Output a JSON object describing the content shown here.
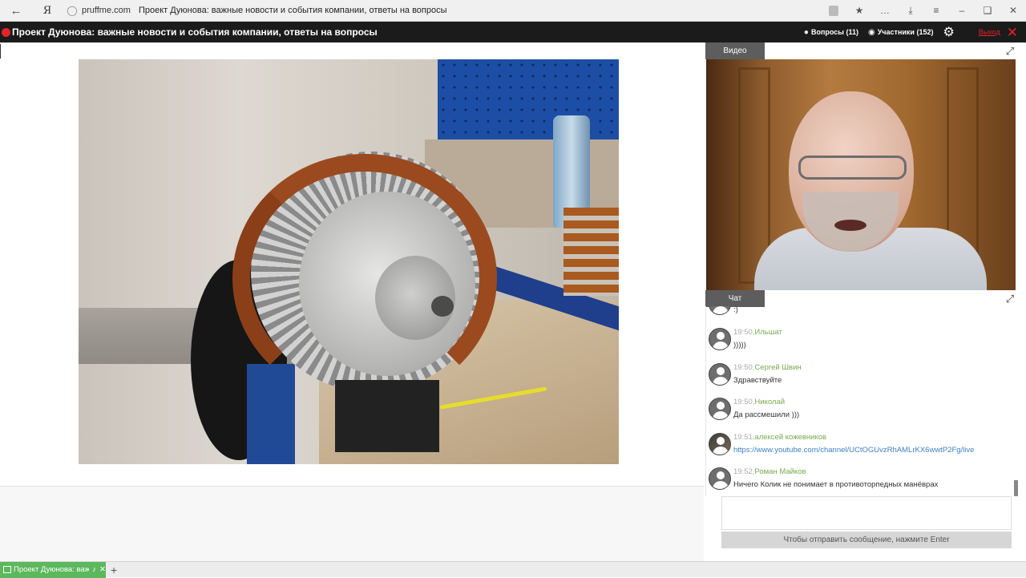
{
  "browser": {
    "back_icon": "arrow-left-icon",
    "logo": "Я",
    "domain": "pruffme.com",
    "page_title": "Проект Дуюнова: важные новости и события компании, ответы на вопросы"
  },
  "header": {
    "title": "Проект Дуюнова: важные новости и события компании, ответы на вопросы",
    "questions_label": "Вопросы (11)",
    "participants_label": "Участники (152)",
    "logout_label": "Выход",
    "accent_color": "#e4232a"
  },
  "video_panel": {
    "tab_label": "Видео"
  },
  "chat_panel": {
    "tab_label": "Чат",
    "partial_first_text": ":)",
    "messages": [
      {
        "time": "19:50",
        "name": "Ильшат",
        "text": ")))))"
      },
      {
        "time": "19:50",
        "name": "Сергей Швин",
        "text": "Здравствуйте"
      },
      {
        "time": "19:50",
        "name": "Николай",
        "text": "Да рассмешили )))"
      },
      {
        "time": "19:51",
        "name": "алексей кожевников",
        "text": "https://www.youtube.com/channel/UCtOGUvzRhAMLrKX6wwtP2Fg/live"
      },
      {
        "time": "19:52",
        "name": "Роман Майков",
        "text": "Ничего Колик не понимает в противоторпедных манёврах"
      }
    ],
    "send_hint": "Чтобы отправить сообщение, нажмите Enter"
  },
  "taskbar": {
    "tab_label": "Проект Дуюнова: важные новости и события компании, ответы на вопросы"
  }
}
